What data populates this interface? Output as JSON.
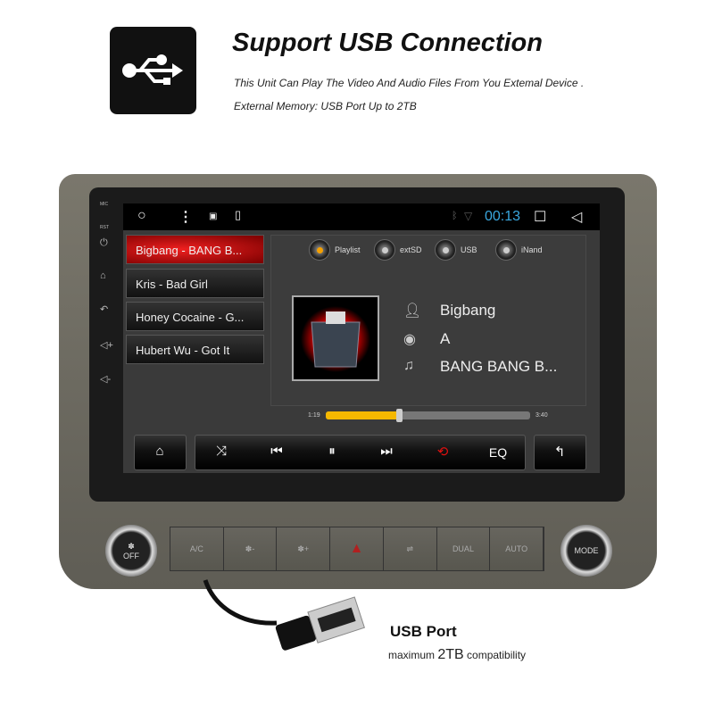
{
  "header": {
    "icon": "usb-icon",
    "title": "Support USB Connection",
    "line1": "This Unit Can Play The Video And Audio Files From You Extemal Device .",
    "line2": "External Memory: USB Port Up to 2TB"
  },
  "side_labels": {
    "mic": "MIC",
    "rst": "RST"
  },
  "status": {
    "time": "00:13",
    "icons": [
      "home-circle-icon",
      "menu-dots-icon",
      "image-icon",
      "sd-card-icon",
      "bluetooth-icon",
      "wifi-icon",
      "recent-apps-icon",
      "back-icon"
    ],
    "time_color": "#3aa8e0"
  },
  "playlist": [
    {
      "label": "Bigbang - BANG B...",
      "selected": true
    },
    {
      "label": "Kris - Bad Girl"
    },
    {
      "label": "Honey Cocaine - G..."
    },
    {
      "label": "Hubert Wu - Got It"
    }
  ],
  "sources": [
    {
      "label": "Playlist",
      "active": true
    },
    {
      "label": "extSD"
    },
    {
      "label": "USB"
    },
    {
      "label": "iNand"
    }
  ],
  "track": {
    "artist": "Bigbang",
    "album": "A",
    "title": "BANG BANG B...",
    "elapsed": "1:19",
    "duration": "3:40",
    "progress_percent": 36
  },
  "controls": {
    "eq": "EQ",
    "icons": [
      "home-icon",
      "shuffle-icon",
      "previous-icon",
      "pause-icon",
      "next-icon",
      "repeat-icon",
      "return-icon"
    ],
    "repeat_color": "#e01010",
    "accent": "#f5b800"
  },
  "climate": {
    "off": "OFF",
    "buttons": [
      "A/C",
      "✽-",
      "✽+",
      "▲",
      "⇌",
      "DUAL",
      "AUTO"
    ],
    "mode": "MODE"
  },
  "footer": {
    "title": "USB Port",
    "caption_pre": "maximum ",
    "caption_big": "2TB",
    "caption_post": " compatibility"
  }
}
